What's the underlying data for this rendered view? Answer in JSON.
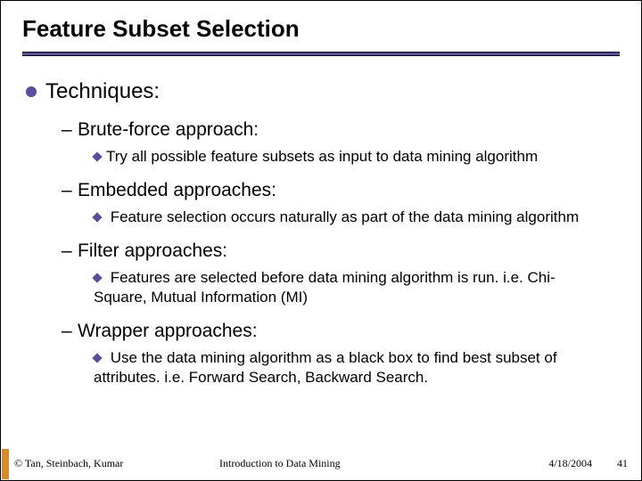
{
  "title": "Feature Subset Selection",
  "lvl1": "Techniques:",
  "items": [
    {
      "heading": "Brute-force approach:",
      "detail": "Try all possible feature subsets as input to data mining algorithm"
    },
    {
      "heading": "Embedded approaches:",
      "detail": " Feature selection occurs naturally as part of the data mining algorithm"
    },
    {
      "heading": "Filter approaches:",
      "detail": " Features are selected before data mining algorithm is run. i.e. Chi-Square, Mutual Information (MI)"
    },
    {
      "heading": "Wrapper approaches:",
      "detail": " Use the data mining algorithm as a black box to find best subset of attributes. i.e. Forward Search, Backward Search."
    }
  ],
  "footer": {
    "left": "© Tan, Steinbach, Kumar",
    "mid": "Introduction to Data Mining",
    "date": "4/18/2004",
    "page": "41"
  }
}
